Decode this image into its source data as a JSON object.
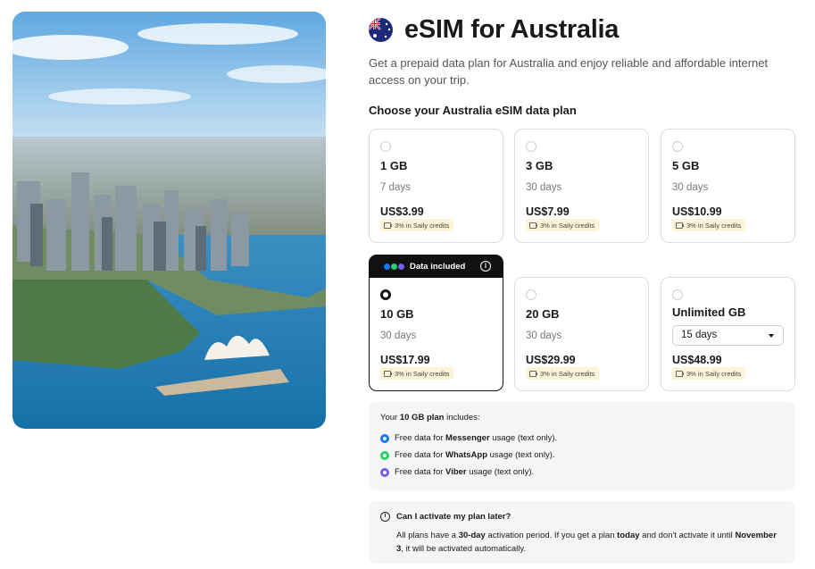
{
  "hero": {
    "image": "sydney-harbour-aerial-photo"
  },
  "header": {
    "flag_icon": "australia-flag-icon",
    "title": "eSIM for Australia",
    "subtitle": "Get a prepaid data plan for Australia and enjoy reliable and affordable internet access on your trip."
  },
  "section": {
    "title": "Choose your Australia eSIM data plan"
  },
  "plans": [
    {
      "size": "1 GB",
      "days": "7 days",
      "price": "US$3.99",
      "credit": "3% in Saily credits",
      "selected": false
    },
    {
      "size": "3 GB",
      "days": "30 days",
      "price": "US$7.99",
      "credit": "3% in Saily credits",
      "selected": false
    },
    {
      "size": "5 GB",
      "days": "30 days",
      "price": "US$10.99",
      "credit": "3% in Saily credits",
      "selected": false
    },
    {
      "size": "10 GB",
      "days": "30 days",
      "price": "US$17.99",
      "credit": "3% in Saily credits",
      "selected": true
    },
    {
      "size": "20 GB",
      "days": "30 days",
      "price": "US$29.99",
      "credit": "3% in Saily credits",
      "selected": false
    },
    {
      "size": "Unlimited GB",
      "days": "15 days",
      "price": "US$48.99",
      "credit": "3% in Saily credits",
      "selected": false
    }
  ],
  "banner": {
    "text": "Data included",
    "info_icon": "info-icon"
  },
  "includes": {
    "prefix": "Your ",
    "plan": "10 GB plan",
    "suffix": " includes:",
    "items": [
      {
        "pre": "Free data for ",
        "app": "Messenger",
        "post": " usage (text only).",
        "color": "#1877f2",
        "icon": "messenger-icon"
      },
      {
        "pre": "Free data for ",
        "app": "WhatsApp",
        "post": " usage (text only).",
        "color": "#25d366",
        "icon": "whatsapp-icon"
      },
      {
        "pre": "Free data for ",
        "app": "Viber",
        "post": " usage (text only).",
        "color": "#7360f2",
        "icon": "viber-icon"
      }
    ]
  },
  "faq": {
    "question": "Can I activate my plan later?",
    "a1": "All plans have a ",
    "a2": "30-day",
    "a3": " activation period. If you get a plan ",
    "a4": "today",
    "a5": " and don't activate it until ",
    "a6": "November 3",
    "a7": ", it will be activated automatically."
  },
  "colors": {
    "selected_border": "#111111",
    "credit_badge_bg": "#fdf3d6",
    "card_border": "#dddddd",
    "panel_bg": "#f5f5f5"
  }
}
